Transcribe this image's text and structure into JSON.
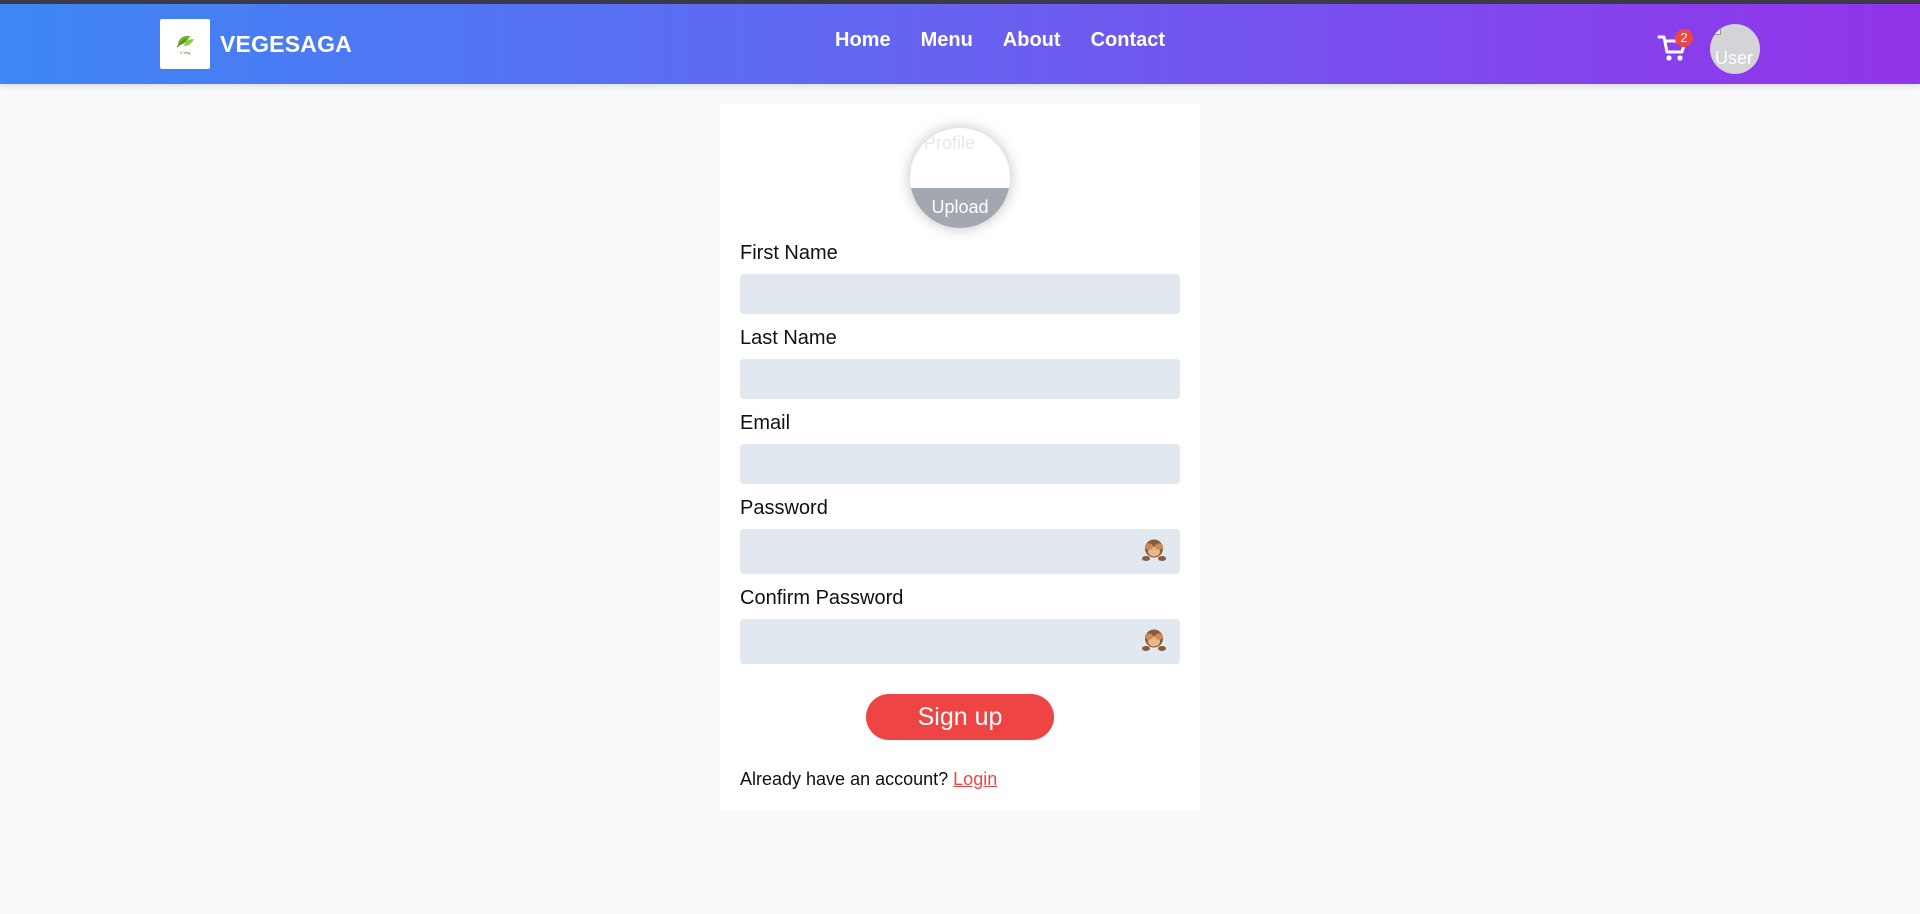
{
  "header": {
    "logo_tiny_text": "V-Veg",
    "brand_name": "VEGESAGA",
    "nav": [
      {
        "label": "Home"
      },
      {
        "label": "Menu"
      },
      {
        "label": "About"
      },
      {
        "label": "Contact"
      }
    ],
    "cart_count": "2",
    "avatar_alt": "User"
  },
  "form": {
    "profile_alt": "Profile",
    "upload_label": "Upload",
    "first_name_label": "First Name",
    "first_name_value": "",
    "last_name_label": "Last Name",
    "last_name_value": "",
    "email_label": "Email",
    "email_value": "",
    "password_label": "Password",
    "password_value": "",
    "confirm_password_label": "Confirm Password",
    "confirm_password_value": "",
    "submit_label": "Sign up",
    "login_prompt": "Already have an account?",
    "login_link": "Login"
  },
  "icons": {
    "cart": "cart-icon",
    "password_toggle": "see-no-evil-monkey-icon"
  },
  "colors": {
    "nav_gradient_start": "#3d86f5",
    "nav_gradient_end": "#9333ea",
    "accent": "#ef4444",
    "field_bg": "#e2e8f0",
    "page_bg": "#f8f9fb"
  }
}
